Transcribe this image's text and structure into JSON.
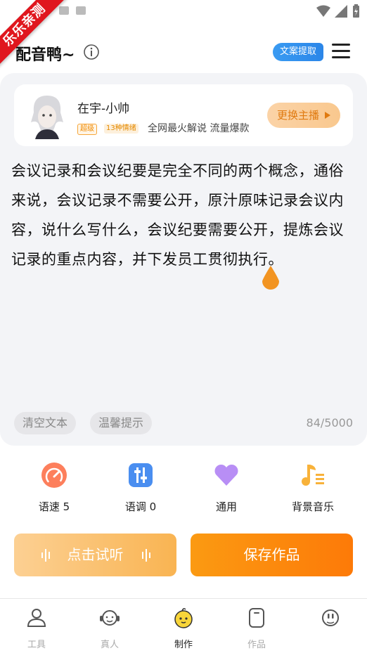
{
  "ribbon": {
    "text": "乐乐亲测"
  },
  "header": {
    "title": "配音鸭~",
    "extract_label": "文案提取"
  },
  "anchor": {
    "name": "在宇-小帅",
    "tag_super": "超级",
    "tag_emotions": "13种情绪",
    "description": "全网最火解说 流量爆款",
    "change_label": "更换主播"
  },
  "editor": {
    "text": "会议记录和会议纪要是完全不同的两个概念，通俗来说，会议记录不需要公开，原汁原味记录会议内容，说什么写什么，会议纪要需要公开，提炼会议记录的重点内容，并下发员工贯彻执行。",
    "clear_label": "清空文本",
    "tip_label": "温馨提示",
    "char_count": "84/5000"
  },
  "controls": {
    "speed_label": "语速 5",
    "pitch_label": "语调 0",
    "style_label": "通用",
    "bgm_label": "背景音乐"
  },
  "actions": {
    "listen_label": "点击试听",
    "save_label": "保存作品"
  },
  "nav": {
    "tools": "工具",
    "real": "真人",
    "make": "制作",
    "works": "作品",
    "mine": ""
  },
  "colors": {
    "accent": "#fb8c10",
    "blue": "#3a9bf2",
    "ribbon": "#e0161e"
  }
}
